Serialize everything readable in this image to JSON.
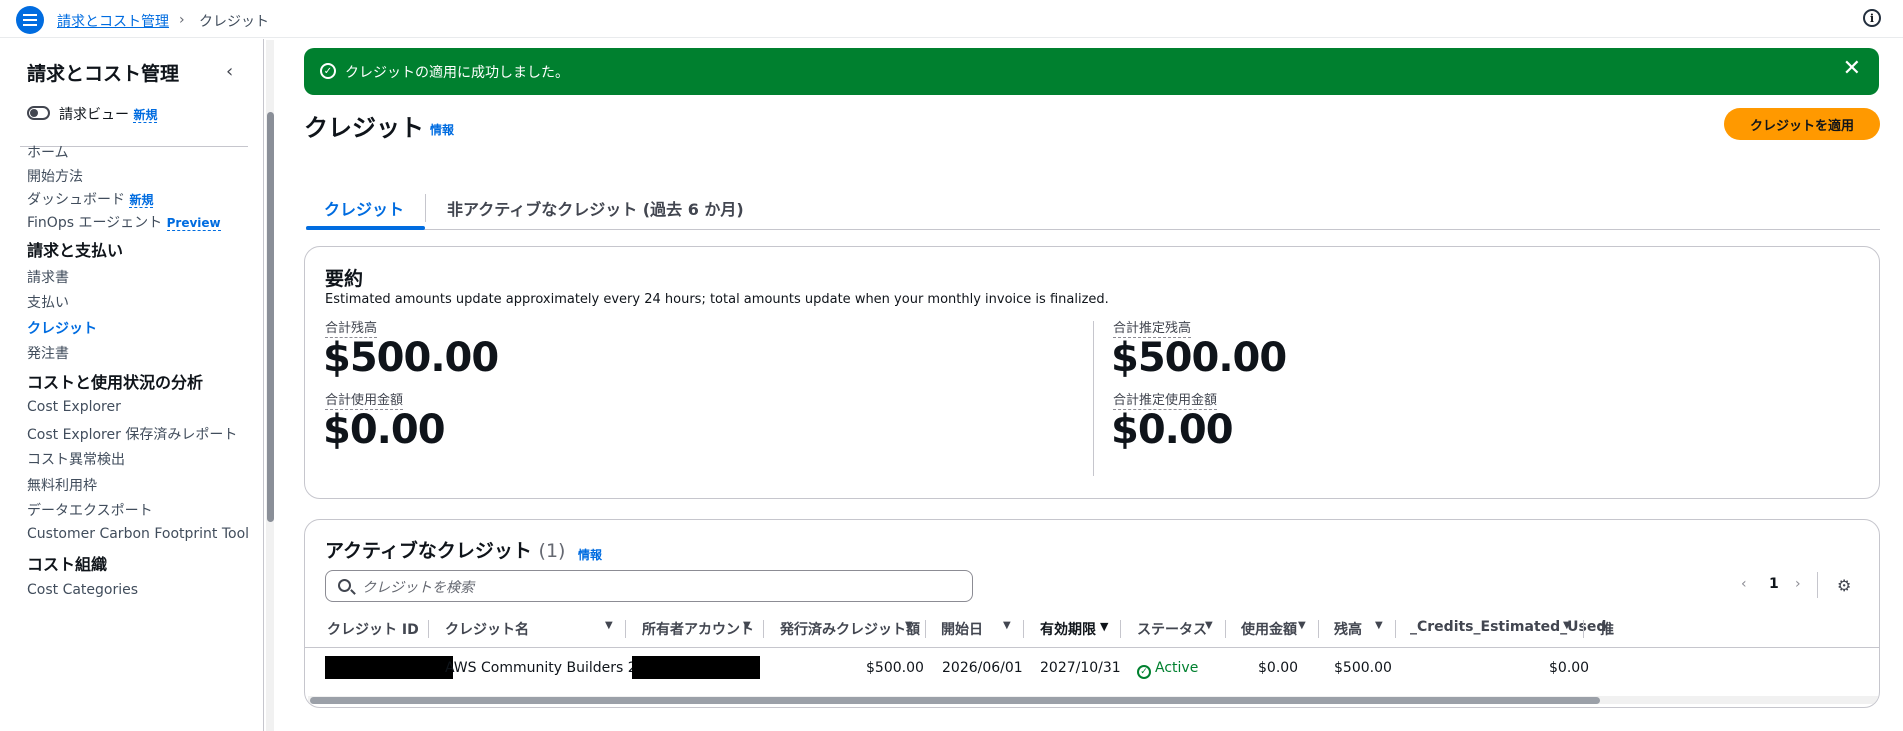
{
  "topbar": {
    "breadcrumb_root": "請求とコスト管理",
    "breadcrumb_sep": "›",
    "breadcrumb_current": "クレジット",
    "info_icon": "ⓘ"
  },
  "sidebar": {
    "title": "請求とコスト管理",
    "collapse_icon": "‹",
    "toggle_label": "請求ビュー",
    "toggle_badge": "新規",
    "items_top": [
      {
        "label": "ホーム"
      },
      {
        "label": "開始方法"
      },
      {
        "label": "ダッシュボード",
        "badge": "新規"
      },
      {
        "label": "FinOps エージェント",
        "badge": "Preview"
      }
    ],
    "section_billing": "請求と支払い",
    "items_billing": [
      {
        "label": "請求書"
      },
      {
        "label": "支払い"
      },
      {
        "label": "クレジット",
        "active": true
      },
      {
        "label": "発注書"
      }
    ],
    "section_analysis": "コストと使用状況の分析",
    "items_analysis": [
      {
        "label": "Cost Explorer"
      },
      {
        "label": "Cost Explorer 保存済みレポート"
      },
      {
        "label": "コスト異常検出"
      },
      {
        "label": "無料利用枠"
      },
      {
        "label": "データエクスポート"
      },
      {
        "label": "Customer Carbon Footprint Tool"
      }
    ],
    "section_org": "コスト組織",
    "items_org": [
      {
        "label": "Cost Categories"
      }
    ]
  },
  "flash": {
    "message": "クレジットの適用に成功しました。",
    "close": "✕",
    "color": "#00802f"
  },
  "page": {
    "title": "クレジット",
    "info": "情報",
    "apply_button": "クレジットを適用"
  },
  "tabs": [
    {
      "label": "クレジット",
      "active": true
    },
    {
      "label": "非アクティブなクレジット (過去 6 か月)"
    }
  ],
  "summary": {
    "title": "要約",
    "description": "Estimated amounts update approximately every 24 hours; total amounts update when your monthly invoice is finalized.",
    "total_balance_label": "合計残高",
    "total_balance": "$500.00",
    "total_used_label": "合計使用金額",
    "total_used": "$0.00",
    "est_balance_label": "合計推定残高",
    "est_balance": "$500.00",
    "est_used_label": "合計推定使用金額",
    "est_used": "$0.00"
  },
  "active_credits": {
    "title": "アクティブなクレジット",
    "count": "(1)",
    "info": "情報",
    "search_placeholder": "クレジットを検索",
    "pager_prev": "‹",
    "pager_page": "1",
    "pager_next": "›",
    "settings_icon": "⚙",
    "columns": [
      "クレジット ID",
      "クレジット名",
      "所有者アカウント",
      "発行済みクレジット額",
      "開始日",
      "有効期限",
      "ステータス",
      "使用金額",
      "残高",
      "_Credits_Estimated_Used_",
      "推"
    ],
    "rows": [
      {
        "credit_name": "AWS Community Builders 2026",
        "issued_amount": "$500.00",
        "start_date": "2026/06/01",
        "expiry_date": "2027/10/31",
        "status": "Active",
        "used": "$0.00",
        "balance": "$500.00",
        "estimated_used": "$0.00"
      }
    ]
  }
}
